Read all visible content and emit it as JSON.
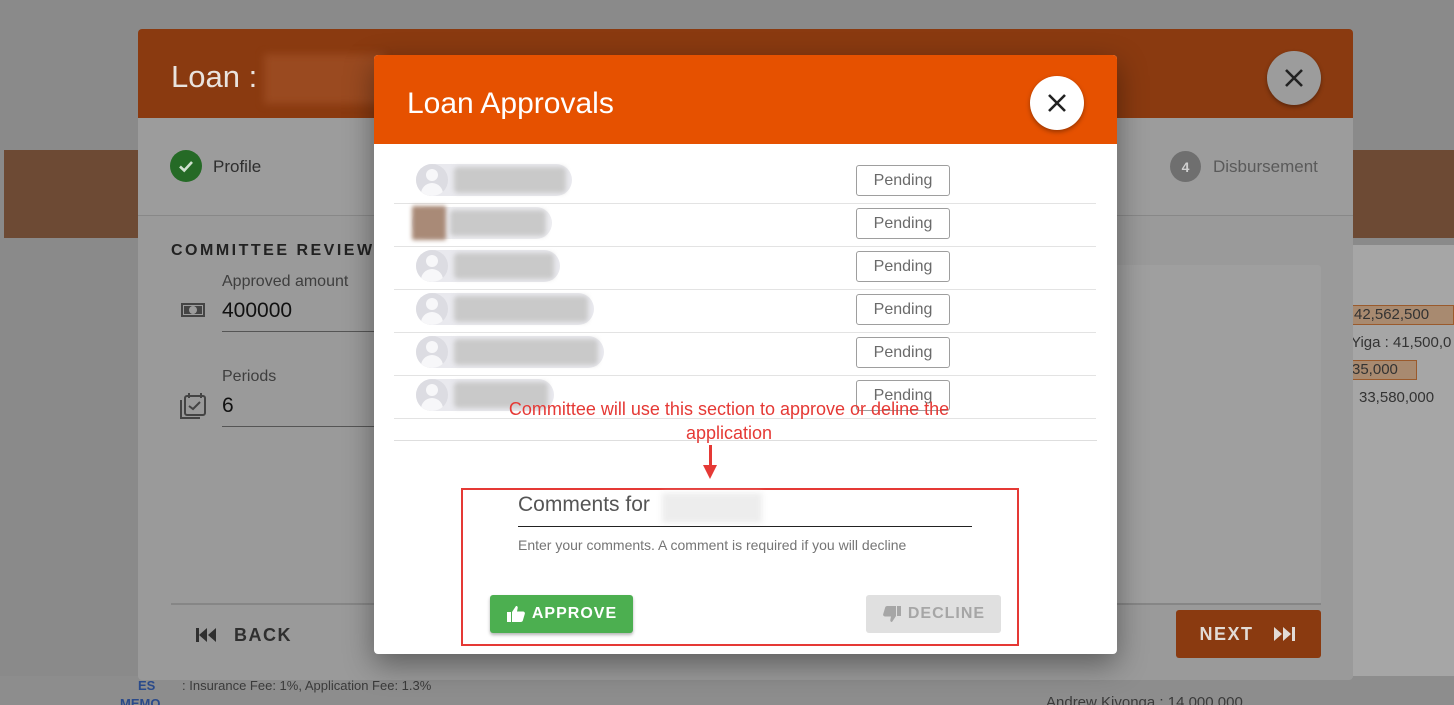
{
  "background": {
    "right_values": [
      "42,562,500",
      "Yiga : 41,500,0",
      "35,000",
      "33,580,000"
    ],
    "bottom_line_1": ": Insurance Fee: 1%, Application Fee: 1.3%",
    "bottom_label_1": "ES",
    "bottom_label_2": "MEMO",
    "bottom_right": "Andrew Kivonga : 14,000,000"
  },
  "loan_dialog": {
    "title": "Loan :",
    "steps": [
      {
        "label": "Profile",
        "status": "done"
      },
      {
        "label": "Disbursement",
        "number": "4",
        "status": "upcoming"
      }
    ],
    "section_title": "COMMITTEE REVIEW",
    "fields": {
      "approved_amount": {
        "label": "Approved amount",
        "value": "400000",
        "icon": "money-icon"
      },
      "periods": {
        "label": "Periods",
        "value": "6",
        "icon": "calendar-check-icon"
      }
    },
    "back_label": "BACK",
    "next_label": "NEXT",
    "accent_color": "#e65100"
  },
  "approvals_dialog": {
    "title": "Loan Approvals",
    "approvers": [
      {
        "status": "Pending"
      },
      {
        "status": "Pending"
      },
      {
        "status": "Pending"
      },
      {
        "status": "Pending"
      },
      {
        "status": "Pending"
      },
      {
        "status": "Pending"
      }
    ],
    "annotation": "Committee will use this section to approve or deline the application",
    "comment_label": "Comments for",
    "comment_hint": "Enter your comments. A comment is required if you will decline",
    "approve_label": "APPROVE",
    "decline_label": "DECLINE",
    "approve_color": "#4caf50",
    "annotation_color": "#e53935"
  }
}
